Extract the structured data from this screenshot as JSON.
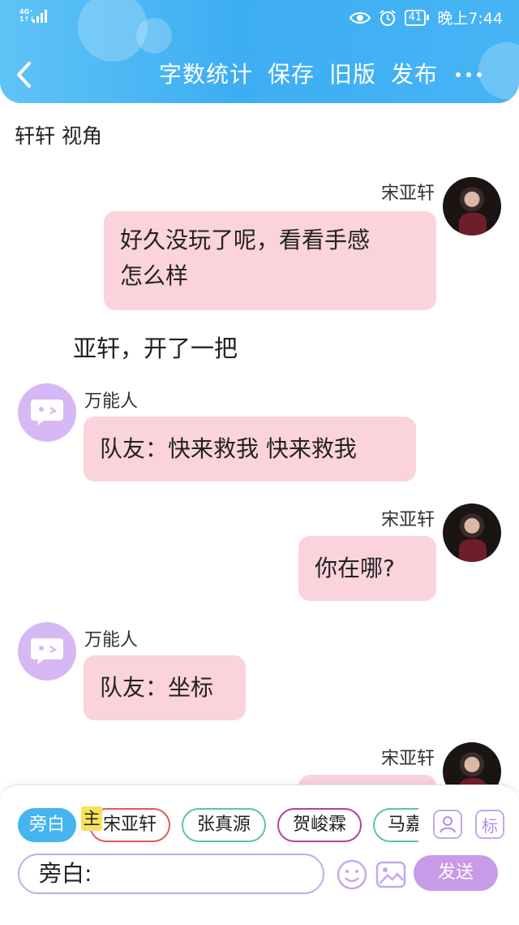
{
  "status_bar": {
    "network": "4G⁺",
    "sub": "1↑↓",
    "battery": "41",
    "time": "晚上7:44"
  },
  "header": {
    "actions": [
      "字数统计",
      "保存",
      "旧版",
      "发布"
    ],
    "accent": "#3eaef2"
  },
  "chat": {
    "perspective": "轩轩 视角",
    "messages": [
      {
        "side": "right",
        "name": "宋亚轩",
        "text_lines": [
          "好久没玩了呢，看看手感",
          "怎么样"
        ]
      },
      {
        "side": "center",
        "text": "亚轩，开了一把"
      },
      {
        "side": "left",
        "name": "万能人",
        "text": "队友：快来救我 快来救我"
      },
      {
        "side": "right",
        "name": "宋亚轩",
        "text": "你在哪?"
      },
      {
        "side": "left",
        "name": "万能人",
        "text": "队友：坐标"
      },
      {
        "side": "right",
        "name": "宋亚轩",
        "text": ""
      }
    ],
    "bubble_color": "#fbd3dc"
  },
  "composer": {
    "roles": [
      {
        "label": "旁白",
        "selected": true
      },
      {
        "label": "宋亚轩",
        "badge": "主",
        "color": "#e05a5a"
      },
      {
        "label": "张真源",
        "color": "#5ec1b6"
      },
      {
        "label": "贺峻霖",
        "color": "#b4409c"
      },
      {
        "label": "马嘉",
        "color": "#5ec1b6"
      }
    ],
    "side_buttons": [
      "person-icon",
      "标"
    ],
    "input_value": "旁白:",
    "send_label": "发送",
    "send_color": "#c89ae8"
  }
}
